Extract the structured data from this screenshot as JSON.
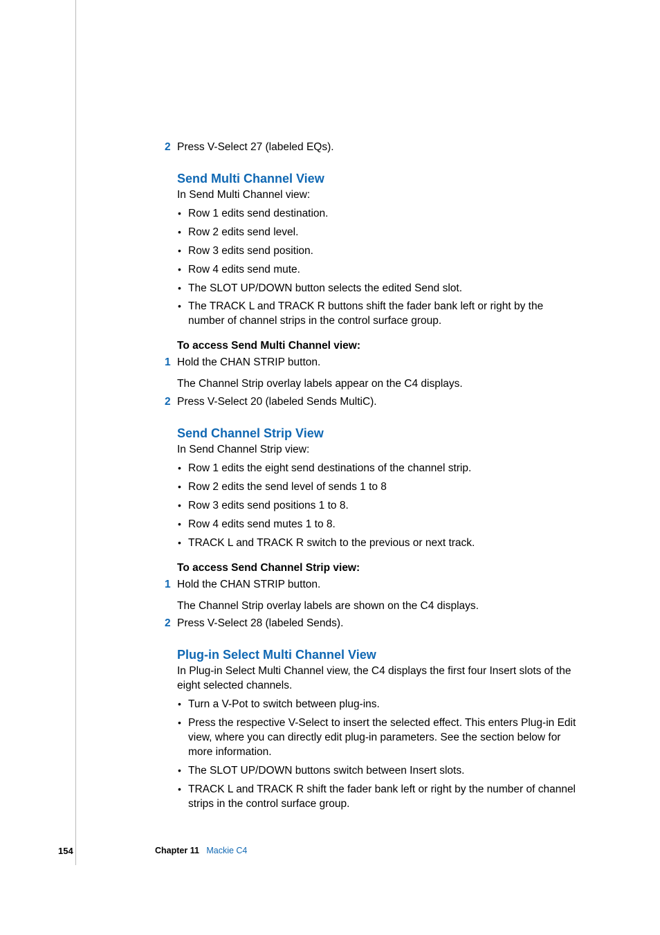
{
  "steps_top": {
    "num": "2",
    "text": "Press V-Select 27 (labeled EQs)."
  },
  "sec1": {
    "heading": "Send Multi Channel View",
    "intro": "In Send Multi Channel view:",
    "bullets": [
      "Row 1 edits send destination.",
      "Row 2 edits send level.",
      "Row 3 edits send position.",
      "Row 4 edits send mute.",
      "The SLOT UP/DOWN button selects the edited Send slot.",
      "The TRACK L and TRACK R buttons shift the fader bank left or right by the number of channel strips in the control surface group."
    ],
    "proc_title": "To access Send Multi Channel view:",
    "step1_num": "1",
    "step1_text": "Hold the CHAN STRIP button.",
    "step1_after": "The Channel Strip overlay labels appear on the C4 displays.",
    "step2_num": "2",
    "step2_text": "Press V-Select 20 (labeled Sends MultiC)."
  },
  "sec2": {
    "heading": "Send Channel Strip View",
    "intro": "In Send Channel Strip view:",
    "bullets": [
      "Row 1 edits the eight send destinations of the channel strip.",
      "Row 2 edits the send level of sends 1 to 8",
      "Row 3 edits send positions 1 to 8.",
      "Row 4 edits send mutes 1 to 8.",
      "TRACK L and TRACK R switch to the previous or next track."
    ],
    "proc_title": "To access Send Channel Strip view:",
    "step1_num": "1",
    "step1_text": "Hold the CHAN STRIP button.",
    "step1_after": "The Channel Strip overlay labels are shown on the C4 displays.",
    "step2_num": "2",
    "step2_text": "Press V-Select 28 (labeled Sends)."
  },
  "sec3": {
    "heading": "Plug-in Select Multi Channel View",
    "intro": "In Plug-in Select Multi Channel view, the C4 displays the first four Insert slots of the eight selected channels.",
    "bullets": [
      "Turn a V-Pot to switch between plug-ins.",
      "Press the respective V-Select to insert the selected effect. This enters Plug-in Edit view, where you can directly edit plug-in parameters. See the section below for more information.",
      "The SLOT UP/DOWN buttons switch between Insert slots.",
      "TRACK L and TRACK R shift the fader bank left or right by the number of channel strips in the control surface group."
    ]
  },
  "footer": {
    "page": "154",
    "chapter_label": "Chapter 11",
    "chapter_link": "Mackie C4"
  }
}
